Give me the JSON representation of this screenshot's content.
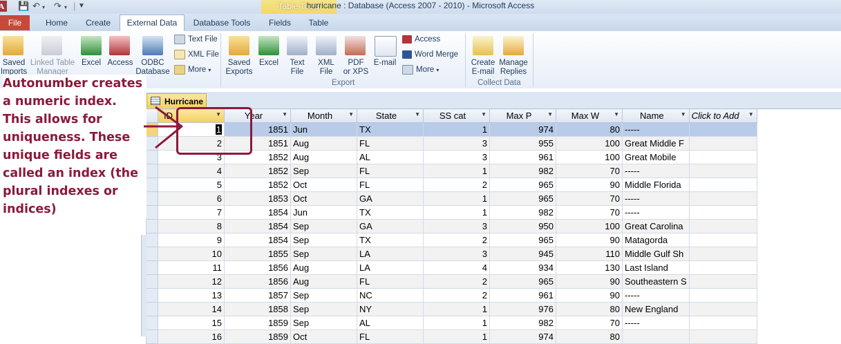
{
  "window": {
    "title": "hurricane : Database (Access 2007 - 2010)  -  Microsoft Access",
    "app_icon": "A",
    "contextual_tab_group": "Table Tools"
  },
  "tabs": [
    {
      "label": "File"
    },
    {
      "label": "Home"
    },
    {
      "label": "Create"
    },
    {
      "label": "External Data",
      "active": true
    },
    {
      "label": "Database Tools"
    },
    {
      "label": "Fields"
    },
    {
      "label": "Table"
    }
  ],
  "ribbon": {
    "import": {
      "saved_imports": [
        "Saved",
        "Imports"
      ],
      "linked_table_manager": [
        "Linked Table",
        "Manager"
      ],
      "excel": "Excel",
      "access": "Access",
      "odbc": [
        "ODBC",
        "Database"
      ],
      "text_file": "Text File",
      "xml_file": "XML File",
      "more": "More"
    },
    "export": {
      "saved_exports": [
        "Saved",
        "Exports"
      ],
      "excel": "Excel",
      "text_file": [
        "Text",
        "File"
      ],
      "xml_file": [
        "XML",
        "File"
      ],
      "pdf": [
        "PDF",
        "or XPS"
      ],
      "email": "E-mail",
      "access": "Access",
      "word_merge": "Word Merge",
      "more": "More",
      "group_label": "Export"
    },
    "collect": {
      "create_email": [
        "Create",
        "E-mail"
      ],
      "manage_replies": [
        "Manage",
        "Replies"
      ],
      "group_label": "Collect Data"
    }
  },
  "annotation": "Autonumber creates a numeric index. This allows for uniqueness. These unique fields are called an index (the plural indexes or indices)",
  "document_tab": "Hurricane",
  "datasheet": {
    "columns": [
      "ID",
      "Year",
      "Month",
      "State",
      "SS cat",
      "Max P",
      "Max W",
      "Name",
      "Click to Add"
    ],
    "rows": [
      [
        "1",
        "1851",
        "Jun",
        "TX",
        "1",
        "974",
        "80",
        "-----"
      ],
      [
        "2",
        "1851",
        "Aug",
        "FL",
        "3",
        "955",
        "100",
        "Great Middle F"
      ],
      [
        "3",
        "1852",
        "Aug",
        "AL",
        "3",
        "961",
        "100",
        "Great Mobile"
      ],
      [
        "4",
        "1852",
        "Sep",
        "FL",
        "1",
        "982",
        "70",
        "-----"
      ],
      [
        "5",
        "1852",
        "Oct",
        "FL",
        "2",
        "965",
        "90",
        "Middle Florida"
      ],
      [
        "6",
        "1853",
        "Oct",
        "GA",
        "1",
        "965",
        "70",
        "-----"
      ],
      [
        "7",
        "1854",
        "Jun",
        "TX",
        "1",
        "982",
        "70",
        "-----"
      ],
      [
        "8",
        "1854",
        "Sep",
        "GA",
        "3",
        "950",
        "100",
        "Great Carolina"
      ],
      [
        "9",
        "1854",
        "Sep",
        "TX",
        "2",
        "965",
        "90",
        "Matagorda"
      ],
      [
        "10",
        "1855",
        "Sep",
        "LA",
        "3",
        "945",
        "110",
        "Middle Gulf Sh"
      ],
      [
        "11",
        "1856",
        "Aug",
        "LA",
        "4",
        "934",
        "130",
        "Last Island"
      ],
      [
        "12",
        "1856",
        "Aug",
        "FL",
        "2",
        "965",
        "90",
        "Southeastern S"
      ],
      [
        "13",
        "1857",
        "Sep",
        "NC",
        "2",
        "961",
        "90",
        "-----"
      ],
      [
        "14",
        "1858",
        "Sep",
        "NY",
        "1",
        "976",
        "80",
        "New England"
      ],
      [
        "15",
        "1859",
        "Sep",
        "AL",
        "1",
        "982",
        "70",
        "-----"
      ],
      [
        "16",
        "1859",
        "Oct",
        "FL",
        "1",
        "974",
        "80",
        ""
      ]
    ]
  },
  "colors": {
    "annotation": "#8b1a3a",
    "file_tab": "#c64a3c",
    "contextual": "#f0d45c",
    "current_row": "#b8cbe8"
  }
}
